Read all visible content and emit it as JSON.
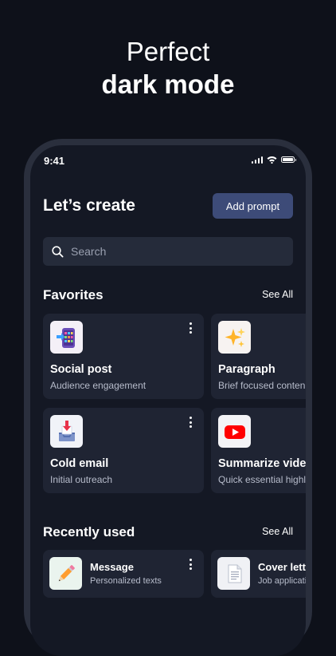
{
  "headline": {
    "line1": "Perfect",
    "line2": "dark mode"
  },
  "status_bar": {
    "time": "9:41"
  },
  "header": {
    "title": "Let’s create",
    "add_prompt_label": "Add prompt"
  },
  "search": {
    "placeholder": "Search"
  },
  "favorites": {
    "title": "Favorites",
    "see_all": "See All",
    "items": [
      {
        "name": "Social post",
        "subtitle": "Audience engagement",
        "icon": "phone-apps-icon"
      },
      {
        "name": "Paragraph",
        "subtitle": "Brief focused conten",
        "icon": "sparkles-icon"
      },
      {
        "name": "Cold email",
        "subtitle": "Initial outreach",
        "icon": "inbox-tray-icon"
      },
      {
        "name": "Summarize video",
        "subtitle": "Quick essential highl",
        "icon": "youtube-play-icon"
      }
    ]
  },
  "recent": {
    "title": "Recently used",
    "see_all": "See All",
    "items": [
      {
        "name": "Message",
        "subtitle": "Personalized texts",
        "icon": "pencil-icon"
      },
      {
        "name": "Cover letter",
        "subtitle": "Job applicatio",
        "icon": "document-icon"
      }
    ]
  }
}
